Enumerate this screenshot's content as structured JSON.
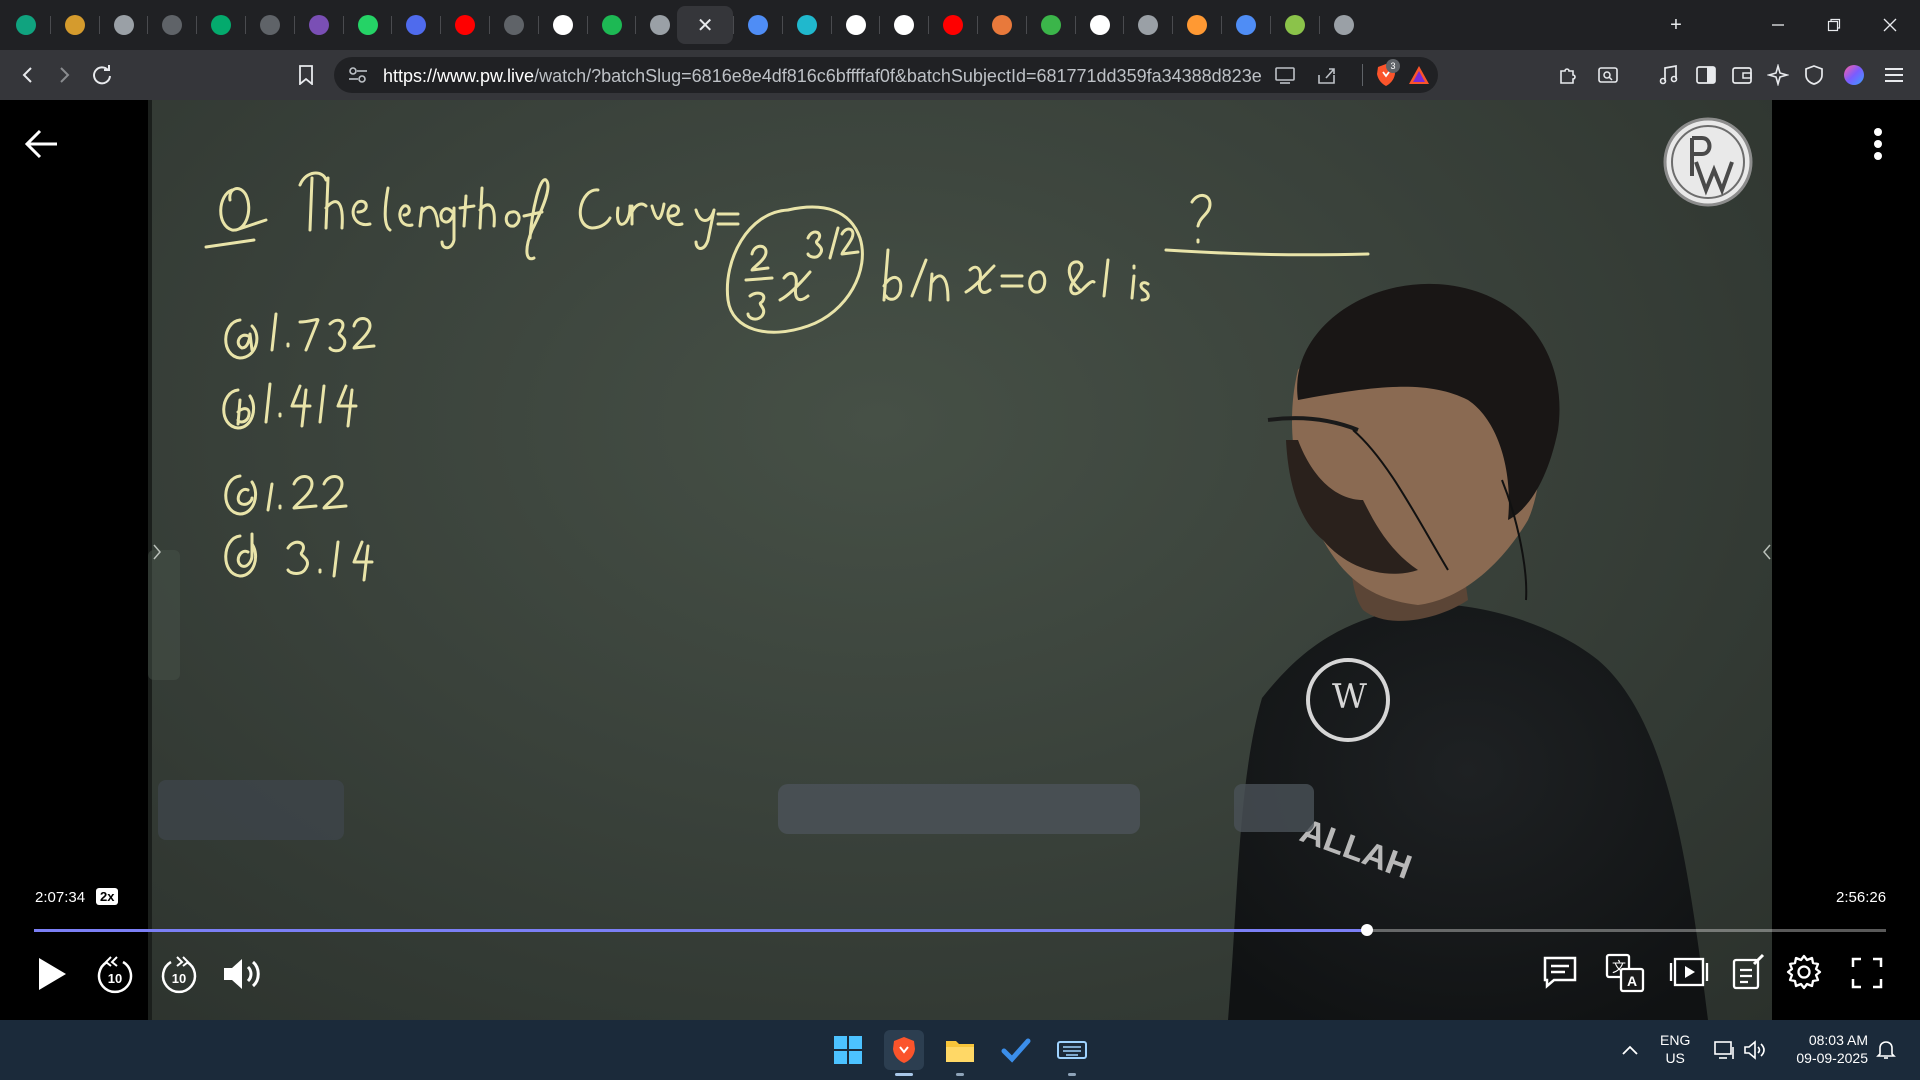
{
  "browser": {
    "tabs": [
      {
        "icon": "chatgpt-icon",
        "color": "#10a37f"
      },
      {
        "icon": "spiral-app-icon",
        "color": "#d59b2d"
      },
      {
        "icon": "globe-icon",
        "color": "#9aa0a6"
      },
      {
        "icon": "app-tile-icon",
        "color": "#5f6368"
      },
      {
        "icon": "w3schools-icon",
        "color": "#04aa6d"
      },
      {
        "icon": "rocket-icon",
        "color": "#5f6368"
      },
      {
        "icon": "purple-orb-icon",
        "color": "#7a4fb5"
      },
      {
        "icon": "whatsapp-icon",
        "color": "#25d366"
      },
      {
        "icon": "bookmark-flag-icon",
        "color": "#4f6bed"
      },
      {
        "icon": "youtube-icon",
        "color": "#ff0000"
      },
      {
        "icon": "settings-badge-icon",
        "color": "#5f6368"
      },
      {
        "icon": "google-icon",
        "color": "#ffffff"
      },
      {
        "icon": "spotify-icon",
        "color": "#1db954"
      },
      {
        "icon": "globe-icon",
        "color": "#9aa0a6"
      },
      {
        "icon": "active-tab",
        "color": "#35363a"
      },
      {
        "icon": "gemini-icon",
        "color": "#4f8df5"
      },
      {
        "icon": "perplexity-icon",
        "color": "#20b8cd"
      },
      {
        "icon": "google-icon",
        "color": "#ffffff"
      },
      {
        "icon": "screen-icon",
        "color": "#ffffff"
      },
      {
        "icon": "youtube-icon",
        "color": "#ff0000"
      },
      {
        "icon": "stripe-ball-icon",
        "color": "#e8793b"
      },
      {
        "icon": "greenhouse-icon",
        "color": "#3bb54a"
      },
      {
        "icon": "wikipedia-icon",
        "color": "#ffffff"
      },
      {
        "icon": "globe-icon",
        "color": "#9aa0a6"
      },
      {
        "icon": "india-flag-icon",
        "color": "#ff9933"
      },
      {
        "icon": "gemini-icon",
        "color": "#4f8df5"
      },
      {
        "icon": "green-ring-icon",
        "color": "#8bc34a"
      },
      {
        "icon": "globe-icon",
        "color": "#9aa0a6"
      }
    ],
    "url_domain": "https://www.pw.live",
    "url_rest": "/watch/?batchSlug=6816e8e4df816c6bffffaf0f&batchSubjectId=681771dd359fa34388d823e...",
    "brave_badge": "3"
  },
  "board": {
    "question_text": "Q. The length of Curve y = (2/3) x^(3/2) b/n x=0 & 1 is ?",
    "options": [
      "a",
      "b",
      "c",
      "d"
    ],
    "option_values": [
      "1.732",
      "1.414",
      "1.22",
      "3.14"
    ]
  },
  "player": {
    "time_current": "2:07:34",
    "speed": "2x",
    "time_total": "2:56:26",
    "progress_fraction": 0.72,
    "accent_color": "#7b7ff5",
    "skip_back": "10",
    "skip_forward": "10"
  },
  "taskbar": {
    "lang_line1": "ENG",
    "lang_line2": "US",
    "time": "08:03 AM",
    "date": "09-09-2025"
  }
}
